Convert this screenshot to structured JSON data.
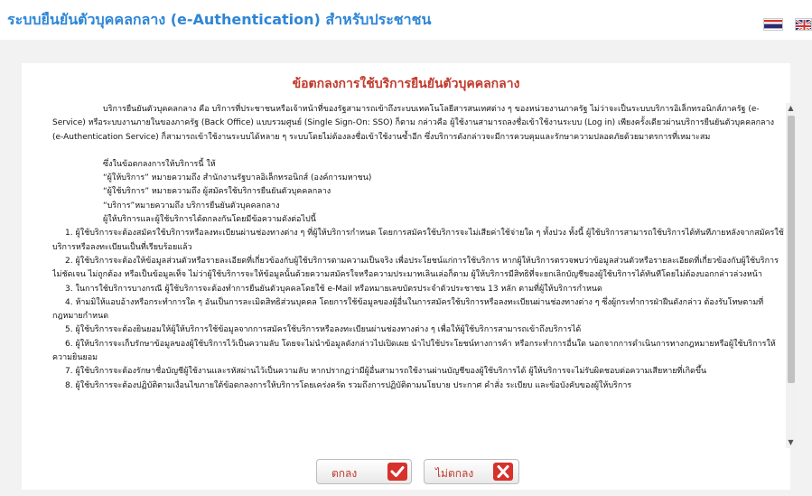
{
  "header": {
    "title": "ระบบยืนยันตัวบุคคลกลาง (e-Authentication) สำหรับประชาชน",
    "flags": [
      "thai-flag-icon",
      "uk-flag-icon"
    ]
  },
  "dialog": {
    "title": "ข้อตกลงการใช้บริการยืนยันตัวบุคคลกลาง",
    "paragraphs": {
      "intro": "บริการยืนยันตัวบุคคลกลาง คือ บริการที่ประชาชนหรือเจ้าหน้าที่ของรัฐสามารถเข้าถึงระบบเทคโนโลยีสารสนเทศต่าง ๆ ของหน่วยงานภาครัฐ ไม่ว่าจะเป็นระบบบริการอิเล็กทรอนิกส์ภาครัฐ (e-Service) หรือระบบงานภายในของภาครัฐ (Back Office) แบบรวมศูนย์ (Single Sign-On: SSO) ก็ตาม กล่าวคือ ผู้ใช้งานสามารถลงชื่อเข้าใช้งานระบบ (Log in) เพียงครั้งเดียวผ่านบริการยืนยันตัวบุคคลกลาง (e-Authentication Service) ก็สามารถเข้าใช้งานระบบได้หลาย ๆ ระบบโดยไม่ต้องลงชื่อเข้าใช้งานซ้ำอีก ซึ่งบริการดังกล่าวจะมีการควบคุมและรักษาความปลอดภัยด้วยมาตรการที่เหมาะสม",
      "def_intro": "ซึ่งในข้อตกลงการให้บริการนี้ ให้",
      "def1": "“ผู้ให้บริการ” หมายความถึง สำนักงานรัฐบาลอิเล็กทรอนิกส์ (องค์การมหาชน)",
      "def2": "“ผู้ใช้บริการ” หมายความถึง ผู้สมัครใช้บริการยืนยันตัวบุคคลกลาง",
      "def3": "“บริการ”หมายความถึง บริการยืนยันตัวบุคคลกลาง",
      "agree": "ผู้ให้บริการและผู้ใช้บริการได้ตกลงกันโดยมีข้อความดังต่อไปนี้",
      "item1": "1. ผู้ใช้บริการจะต้องสมัครใช้บริการหรือลงทะเบียนผ่านช่องทางต่าง ๆ ที่ผู้ให้บริการกำหนด โดยการสมัครใช้บริการจะไม่เสียค่าใช้จ่ายใด ๆ ทั้งปวง ทั้งนี้ ผู้ใช้บริการสามารถใช้บริการได้ทันทีภายหลังจากสมัครใช้บริการหรือลงทะเบียนเป็นที่เรียบร้อยแล้ว",
      "item2": "2. ผู้ใช้บริการจะต้องให้ข้อมูลส่วนตัวหรือรายละเอียดที่เกี่ยวข้องกับผู้ใช้บริการตามความเป็นจริง เพื่อประโยชน์แก่การใช้บริการ หากผู้ให้บริการตรวจพบว่าข้อมูลส่วนตัวหรือรายละเอียดที่เกี่ยวข้องกับผู้ใช้บริการไม่ชัดเจน ไม่ถูกต้อง หรือเป็นข้อมูลเท็จ ไม่ว่าผู้ใช้บริการจะให้ข้อมูลนั้นด้วยความสมัครใจหรือความประมาทเลินเล่อก็ตาม ผู้ให้บริการมีสิทธิที่จะยกเลิกบัญชีของผู้ใช้บริการได้ทันทีโดยไม่ต้องบอกกล่าวล่วงหน้า",
      "item3": "3. ในการใช้บริการบางกรณี ผู้ใช้บริการจะต้องทำการยืนยันตัวบุคคลโดยใช้ e-Mail หรือหมายเลขบัตรประจำตัวประชาชน 13 หลัก ตามที่ผู้ให้บริการกำหนด",
      "item4": "4. ห้ามมิให้แอบอ้างหรือกระทำการใด ๆ อันเป็นการละเมิดสิทธิส่วนบุคคล โดยการใช้ข้อมูลของผู้อื่นในการสมัครใช้บริการหรือลงทะเบียนผ่านช่องทางต่าง ๆ ซึ่งผู้กระทำการฝ่าฝืนดังกล่าว ต้องรับโทษตามที่กฎหมายกำหนด",
      "item5": "5. ผู้ใช้บริการจะต้องยินยอมให้ผู้ให้บริการใช้ข้อมูลจากการสมัครใช้บริการหรือลงทะเบียนผ่านช่องทางต่าง ๆ เพื่อให้ผู้ใช้บริการสามารถเข้าถึงบริการได้",
      "item6": "6. ผู้ให้บริการจะเก็บรักษาข้อมูลของผู้ใช้บริการไว้เป็นความลับ โดยจะไม่นำข้อมูลดังกล่าวไปเปิดเผย นำไปใช้ประโยชน์ทางการค้า หรือกระทำการอื่นใด นอกจากการดำเนินการทางกฎหมายหรือผู้ใช้บริการให้ความยินยอม",
      "item7": "7. ผู้ใช้บริการจะต้องรักษาชื่อบัญชีผู้ใช้งานและรหัสผ่านไว้เป็นความลับ หากปรากฏว่ามีผู้อื่นสามารถใช้งานผ่านบัญชีของผู้ใช้บริการได้ ผู้ให้บริการจะไม่รับผิดชอบต่อความเสียหายที่เกิดขึ้น",
      "item8": "8. ผู้ใช้บริการจะต้องปฏิบัติตามเงื่อนไขภายใต้ข้อตกลงการให้บริการโดยเคร่งครัด รวมถึงการปฏิบัติตามนโยบาย ประกาศ คำสั่ง ระเบียบ และข้อบังคับของผู้ให้บริการ"
    }
  },
  "buttons": {
    "accept_label": "ตกลง",
    "accept_icon": "check-icon",
    "decline_label": "ไม่ตกลง",
    "decline_icon": "x-icon"
  },
  "colors": {
    "title_blue": "#2f86d6",
    "dialog_title_red": "#c0392b",
    "button_icon_red": "#d6312b"
  }
}
